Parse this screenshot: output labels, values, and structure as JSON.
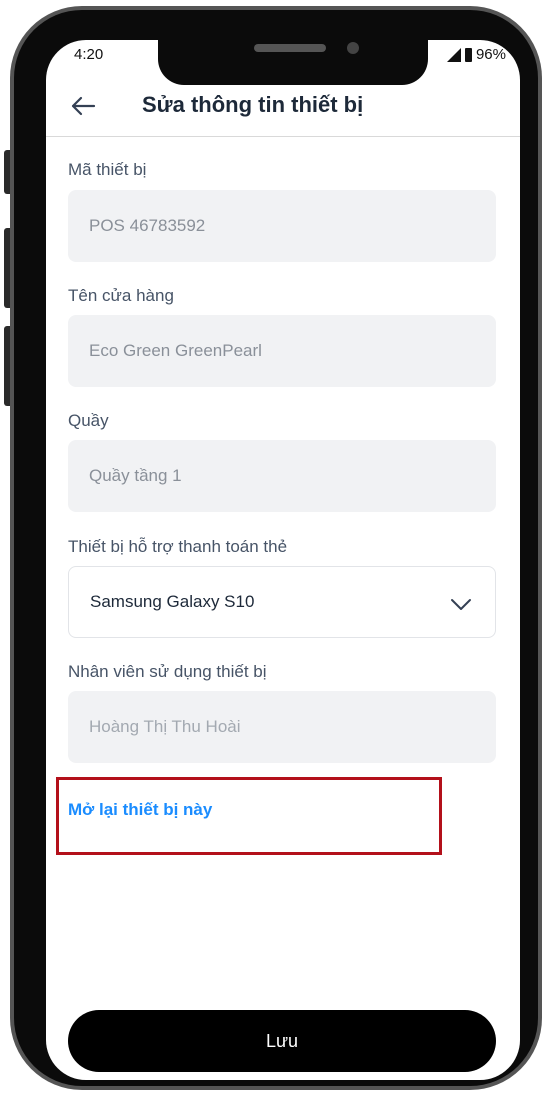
{
  "status_bar": {
    "time": "4:20",
    "battery": "96%"
  },
  "header": {
    "title": "Sửa thông tin thiết bị"
  },
  "form": {
    "device_code": {
      "label": "Mã thiết bị",
      "value": "POS 46783592"
    },
    "store_name": {
      "label": "Tên cửa hàng",
      "value": "Eco Green GreenPearl"
    },
    "counter": {
      "label": "Quầy",
      "value": "Quầy tầng 1"
    },
    "card_device": {
      "label": "Thiết bị hỗ trợ thanh toán thẻ",
      "value": "Samsung Galaxy S10"
    },
    "employee": {
      "label": "Nhân viên sử dụng thiết bị",
      "value": "Hoàng Thị Thu Hoài"
    }
  },
  "reopen_link": "Mở lại thiết bị này",
  "save_label": "Lưu",
  "colors": {
    "accent_link": "#1a8cff",
    "highlight_box": "#b3101a",
    "primary_button": "#000000"
  }
}
